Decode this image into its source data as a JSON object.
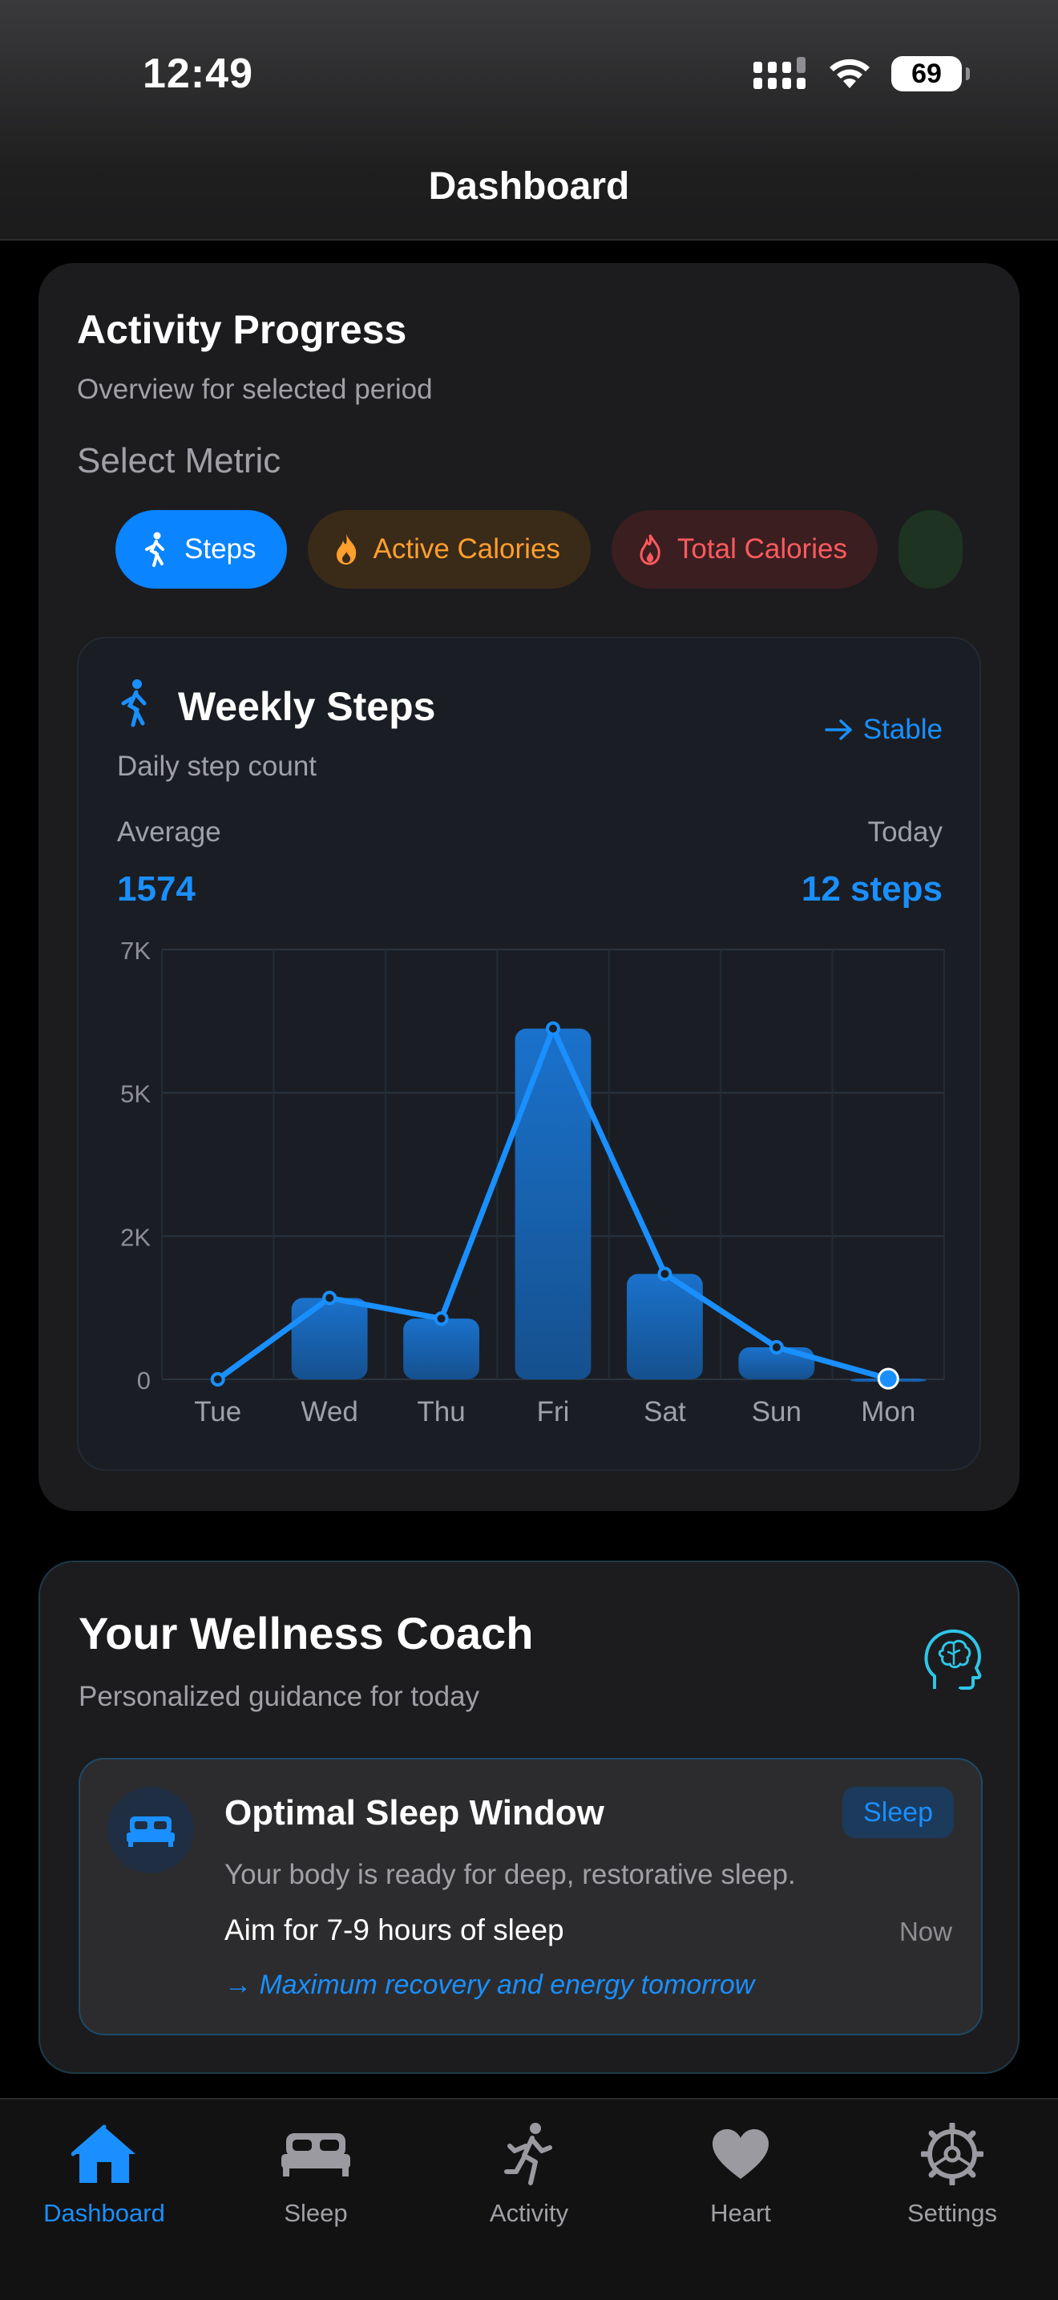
{
  "status_bar": {
    "time": "12:49",
    "battery": "69"
  },
  "header": {
    "title": "Dashboard"
  },
  "activity": {
    "title": "Activity Progress",
    "subtitle": "Overview for selected period",
    "select_label": "Select Metric",
    "metrics": [
      {
        "label": "Steps",
        "selected": true
      },
      {
        "label": "Active Calories",
        "selected": false
      },
      {
        "label": "Total Calories",
        "selected": false
      }
    ]
  },
  "weekly": {
    "title": "Weekly Steps",
    "subtitle": "Daily step count",
    "trend": "Stable",
    "average_label": "Average",
    "average_value": "1574",
    "today_label": "Today",
    "today_value": "12 steps"
  },
  "chart_data": {
    "type": "bar",
    "categories": [
      "Tue",
      "Wed",
      "Thu",
      "Fri",
      "Sat",
      "Sun",
      "Mon"
    ],
    "values": [
      0,
      1420,
      1060,
      6120,
      1840,
      560,
      12
    ],
    "ylim": [
      0,
      7500
    ],
    "yticks": [
      0,
      2500,
      5000,
      7500
    ],
    "ytick_labels": [
      "0",
      "2K",
      "5K",
      "7K"
    ],
    "grid": true,
    "overlay_line": true,
    "colors": {
      "bar": "#1a6fc4",
      "line": "#1a8fff"
    }
  },
  "coach": {
    "title": "Your Wellness Coach",
    "subtitle": "Personalized guidance for today",
    "tip": {
      "title": "Optimal Sleep Window",
      "badge": "Sleep",
      "body": "Your body is ready for deep, restorative sleep.",
      "action": "Aim for 7-9 hours of sleep",
      "time": "Now",
      "benefit": "→ Maximum recovery and energy tomorrow"
    }
  },
  "tabbar": {
    "items": [
      {
        "label": "Dashboard",
        "icon": "house-icon",
        "active": true
      },
      {
        "label": "Sleep",
        "icon": "bed-icon",
        "active": false
      },
      {
        "label": "Activity",
        "icon": "runner-icon",
        "active": false
      },
      {
        "label": "Heart",
        "icon": "heart-icon",
        "active": false
      },
      {
        "label": "Settings",
        "icon": "gear-icon",
        "active": false
      }
    ]
  },
  "colors": {
    "accent": "#0a84ff",
    "orange": "#ff9f2e",
    "red": "#ff5a5f"
  }
}
